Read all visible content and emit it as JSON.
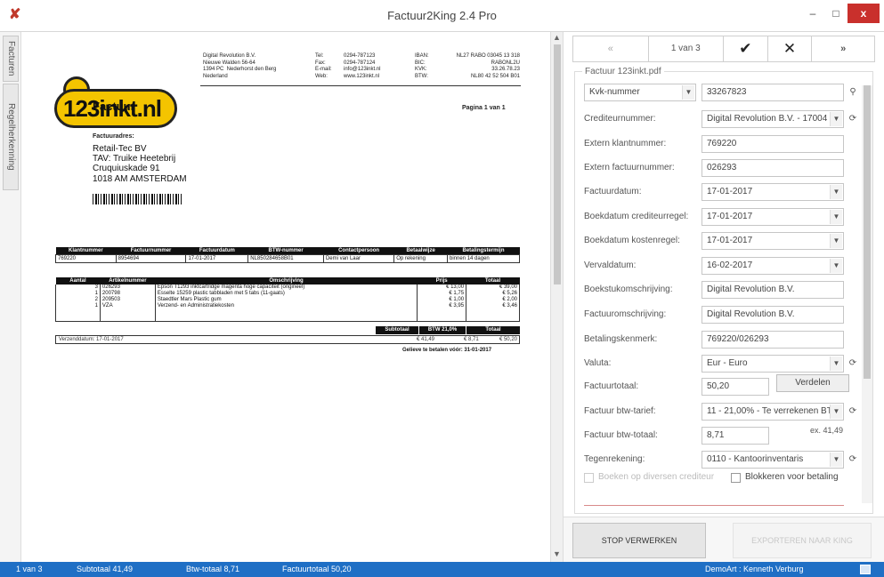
{
  "window": {
    "title": "Factuur2King 2.4 Pro",
    "minimize": "–",
    "maximize": "□",
    "close": "x"
  },
  "sidebar_tabs": [
    "Facturen",
    "Regelherkenning"
  ],
  "document": {
    "logo_text": "123inkt.nl",
    "company_block": "Digital Revolution B.V.\nNieuwe Walden 56-64\n1394 PC  Nederhorst den Berg\nNederland",
    "contact_labels": "Tel:\nFax:\nE-mail:\nWeb:",
    "contact_values": "0294-787123\n0294-787124\ninfo@123inkt.nl\nwww.123inkt.nl",
    "bank_labels": "IBAN:\nBIC:\nKVK:\nBTW:",
    "bank_values": "NL27 RABO 03045 13 318\nRABONL2U\n33.26.78.23\nNL80 42 52 504 B01",
    "title": "Factuur",
    "page": "Pagina 1 van 1",
    "address_label": "Factuuradres:",
    "address_lines": [
      "Retail-Tec BV",
      "TAV: Truike Heetebrij",
      "Cruquiuskade 91",
      "1018 AM  AMSTERDAM"
    ],
    "meta_headers": [
      "Klantnummer",
      "Factuurnummer",
      "Factuurdatum",
      "BTW-nummer",
      "Contactpersoon",
      "Betaalwijze",
      "Betalingstermijn"
    ],
    "meta_values": [
      "769220",
      "8954694",
      "17-01-2017",
      "NL850284658B01",
      "Demi van Laar",
      "Op rekening",
      "binnen 14 dagen"
    ],
    "line_headers": [
      "Aantal",
      "Artikelnummer",
      "Omschrijving",
      "Prijs",
      "Totaal"
    ],
    "lines": [
      [
        "3",
        "026293",
        "Epson T1293 inktcartridge magenta hoge capaciteit (origineel)",
        "€ 13,00",
        "€ 39,00"
      ],
      [
        "1",
        "200798",
        "Esselte 15259 plastic tabbladen met 5 tabs (11-gaats)",
        "€ 1,75",
        "€ 5,26"
      ],
      [
        "2",
        "209503",
        "Staedtler Mars Plastic gum",
        "€ 1,00",
        "€ 2,00"
      ],
      [
        "1",
        "VZA",
        "Verzend- en Administratiekosten",
        "€ 3,95",
        "€ 3,46"
      ]
    ],
    "totals_headers": [
      "Subtotaal",
      "BTW 21,0%",
      "Totaal"
    ],
    "totals_values": [
      "€ 41,49",
      "€ 8,71",
      "€ 50,20"
    ],
    "ship_date": "Verzenddatum: 17-01-2017",
    "due_text": "Gelieve te betalen vóór: 31-01-2017"
  },
  "nav": {
    "prev": "«",
    "page": "1 van 3",
    "ok": "✔",
    "reject": "✕",
    "next": "»"
  },
  "form": {
    "group_title": "Factuur 123inkt.pdf",
    "search_type": "Kvk-nummer",
    "search_value": "33267823",
    "fields": [
      {
        "label": "Crediteurnummer:",
        "value": "Digital Revolution B.V. - 17004"
      },
      {
        "label": "Extern klantnummer:",
        "value": "769220"
      },
      {
        "label": "Extern factuurnummer:",
        "value": "026293"
      },
      {
        "label": "Factuurdatum:",
        "value": "17-01-2017"
      },
      {
        "label": "Boekdatum crediteurregel:",
        "value": "17-01-2017"
      },
      {
        "label": "Boekdatum kostenregel:",
        "value": "17-01-2017"
      },
      {
        "label": "Vervaldatum:",
        "value": "16-02-2017"
      },
      {
        "label": "Boekstukomschrijving:",
        "value": "Digital Revolution B.V."
      },
      {
        "label": "Factuuromschrijving:",
        "value": "Digital Revolution B.V."
      },
      {
        "label": "Betalingskenmerk:",
        "value": "769220/026293"
      },
      {
        "label": "Valuta:",
        "value": "Eur - Euro"
      },
      {
        "label": "Factuurtotaal:",
        "value": "50,20"
      },
      {
        "label": "Factuur btw-tarief:",
        "value": "11 - 21,00% - Te verrekenen BT"
      },
      {
        "label": "Factuur btw-totaal:",
        "value": "8,71"
      },
      {
        "label": "Tegenrekening:",
        "value": "0110 - Kantoorinventaris"
      }
    ],
    "verdelen": "Verdelen",
    "ex_label": "ex. 41,49",
    "check_diverse": "Boeken op diversen crediteur",
    "check_block": "Blokkeren voor betaling"
  },
  "buttons": {
    "stop": "STOP VERWERKEN",
    "export": "EXPORTEREN NAAR KING"
  },
  "status": {
    "page": "1 van 3",
    "subtotal": "Subtotaal  41,49",
    "vat": "Btw-totaal  8,71",
    "total": "Factuurtotaal  50,20",
    "user": "DemoArt  :  Kenneth Verburg"
  }
}
